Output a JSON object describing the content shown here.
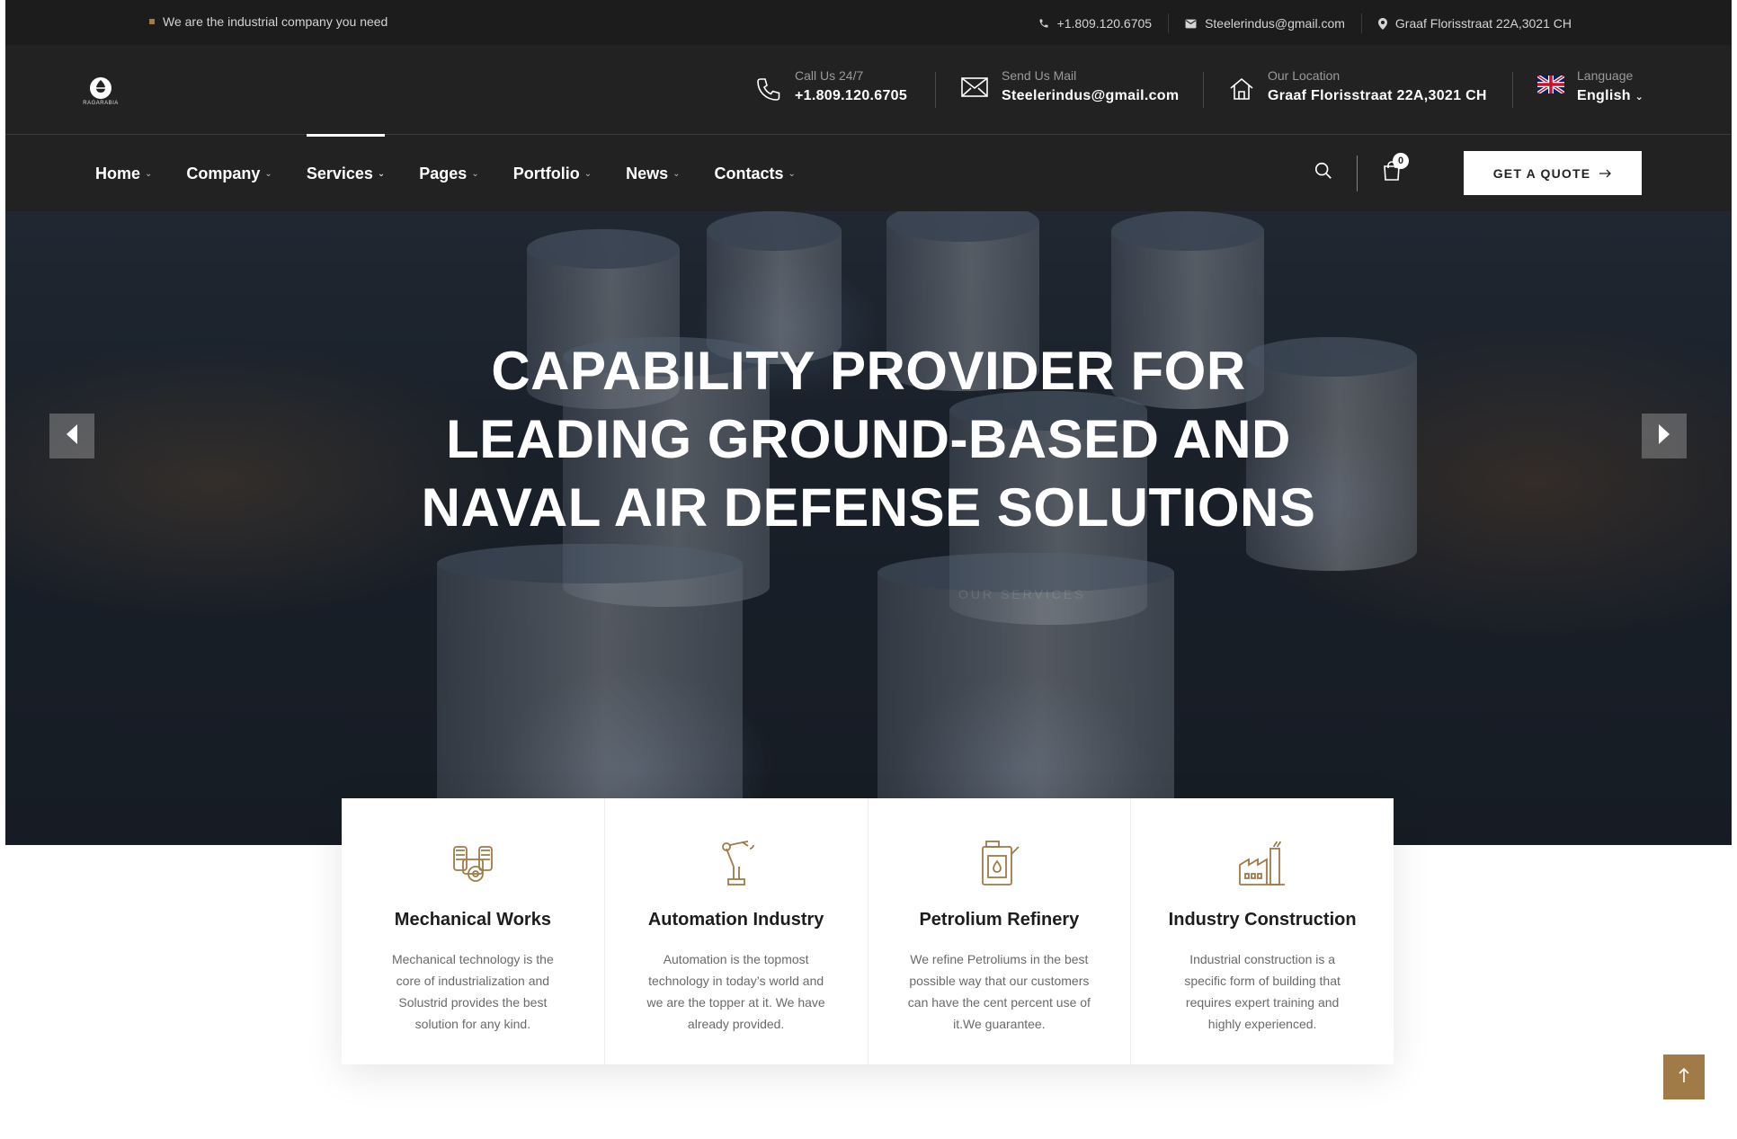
{
  "topbar": {
    "tagline": "We are the industrial company you need",
    "phone": "+1.809.120.6705",
    "email": "Steelerindus@gmail.com",
    "address": "Graaf Florisstraat 22A,3021 CH"
  },
  "header": {
    "logo_text": "RAGARABIA",
    "call": {
      "label": "Call Us 24/7",
      "value": "+1.809.120.6705"
    },
    "mail": {
      "label": "Send Us Mail",
      "value": "Steelerindus@gmail.com"
    },
    "location": {
      "label": "Our Location",
      "value": "Graaf Florisstraat 22A,3021 CH"
    },
    "language": {
      "label": "Language",
      "value": "English"
    }
  },
  "nav": {
    "items": [
      {
        "label": "Home"
      },
      {
        "label": "Company"
      },
      {
        "label": "Services"
      },
      {
        "label": "Pages"
      },
      {
        "label": "Portfolio"
      },
      {
        "label": "News"
      },
      {
        "label": "Contacts"
      }
    ],
    "active": "Services",
    "cart_count": "0",
    "quote_label": "GET A QUOTE"
  },
  "hero": {
    "title_lines": [
      "CAPABILITY PROVIDER FOR",
      "LEADING GROUND-BASED AND",
      "NAVAL AIR DEFENSE SOLUTIONS"
    ],
    "faint_label": "OUR SERVICES"
  },
  "services": [
    {
      "title": "Mechanical Works",
      "desc": "Mechanical technology is the core of industrialization and Solustrid provides the best solution for any kind.",
      "icon": "engine-icon"
    },
    {
      "title": "Automation Industry",
      "desc": "Automation is the topmost technology in today’s world and we are the topper at it. We have already provided.",
      "icon": "robot-arm-icon"
    },
    {
      "title": "Petrolium Refinery",
      "desc": "We refine Petroliums in the best possible way that our customers can have the cent percent use of it.We guarantee.",
      "icon": "oil-canister-icon"
    },
    {
      "title": "Industry Construction",
      "desc": "Industrial construction is a specific form of building that requires expert training and highly experienced.",
      "icon": "factory-icon"
    }
  ],
  "colors": {
    "accent": "#a07a47",
    "dark": "#222222",
    "topbar": "#1c1c1c"
  }
}
